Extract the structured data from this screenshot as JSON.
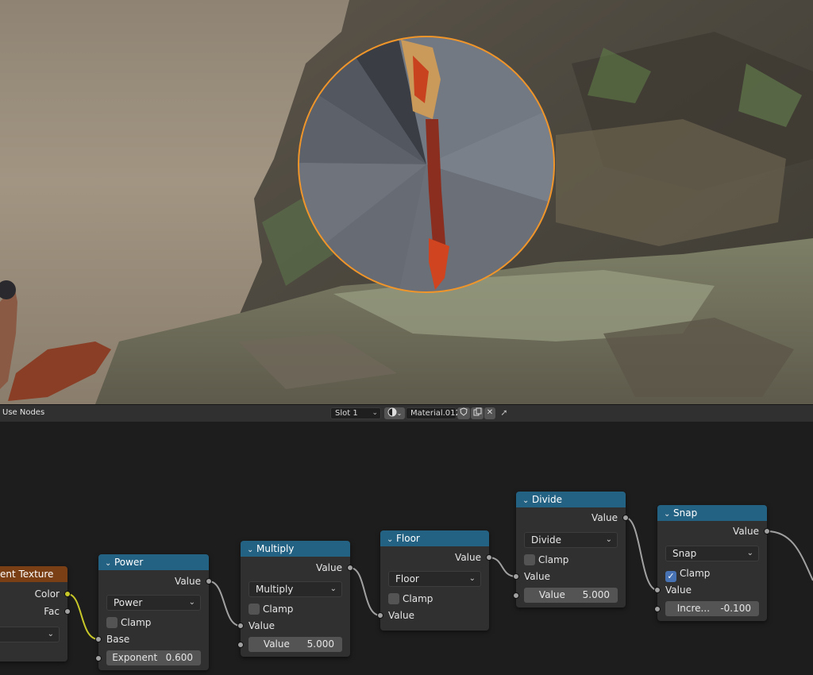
{
  "header": {
    "use_nodes": "Use Nodes",
    "slot": "Slot 1",
    "material": "Material.012",
    "icons": [
      "sphere-preview-icon",
      "shield-icon",
      "duplicate-icon",
      "close-icon",
      "pin-icon"
    ]
  },
  "nodes": {
    "gradient": {
      "title": "ent Texture",
      "outputs": [
        "Color",
        "Fac"
      ]
    },
    "power": {
      "title": "Power",
      "output": "Value",
      "operation": "Power",
      "clamp_label": "Clamp",
      "clamp_checked": false,
      "input_base": "Base",
      "field_label": "Exponent",
      "field_value": "0.600"
    },
    "multiply": {
      "title": "Multiply",
      "output": "Value",
      "operation": "Multiply",
      "clamp_label": "Clamp",
      "clamp_checked": false,
      "input_value": "Value",
      "field_label": "Value",
      "field_value": "5.000"
    },
    "floor": {
      "title": "Floor",
      "output": "Value",
      "operation": "Floor",
      "clamp_label": "Clamp",
      "clamp_checked": false,
      "input_value": "Value"
    },
    "divide": {
      "title": "Divide",
      "output": "Value",
      "operation": "Divide",
      "clamp_label": "Clamp",
      "clamp_checked": false,
      "input_value": "Value",
      "field_label": "Value",
      "field_value": "5.000"
    },
    "snap": {
      "title": "Snap",
      "output": "Value",
      "operation": "Snap",
      "clamp_label": "Clamp",
      "clamp_checked": true,
      "input_value": "Value",
      "field_label": "Incre...",
      "field_value": "-0.100"
    }
  },
  "colors": {
    "node_header": "#246283",
    "texture_header": "#7a3f15",
    "selection_outline": "#f0952a",
    "color_socket": "#c7c729"
  }
}
